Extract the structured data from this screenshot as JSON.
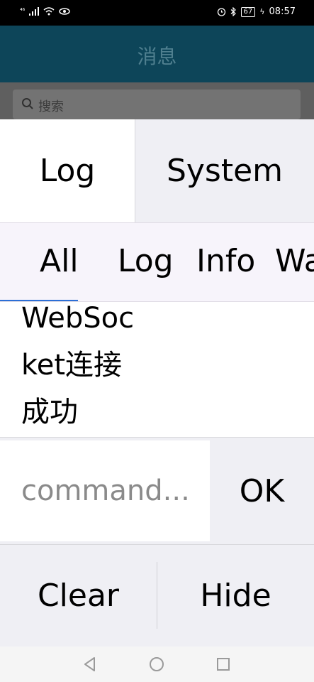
{
  "status_bar": {
    "signal_label": "⁴⁶",
    "time": "08:57",
    "battery": "67"
  },
  "app_bar": {
    "title": "消息"
  },
  "search": {
    "placeholder": "搜索"
  },
  "console": {
    "top_tabs": [
      {
        "label": "Log",
        "selected": true
      },
      {
        "label": "System",
        "selected": false
      }
    ],
    "filter_tabs": [
      {
        "label": "All",
        "selected": true
      },
      {
        "label": "Log",
        "selected": false
      },
      {
        "label": "Info",
        "selected": false
      },
      {
        "label": "Wa",
        "selected": false
      }
    ],
    "log_entries": [
      {
        "text": "WebSocket连接成功"
      }
    ],
    "command": {
      "placeholder": "command...",
      "value": ""
    },
    "ok_label": "OK",
    "clear_label": "Clear",
    "hide_label": "Hide"
  },
  "nav_bar": {
    "buttons": [
      "back",
      "home",
      "recent"
    ]
  },
  "colors": {
    "app_bar": "#0d4559",
    "panel_gray": "#efeff4",
    "filter_bg": "#f7f4fb",
    "indicator": "#2c6fd6"
  }
}
